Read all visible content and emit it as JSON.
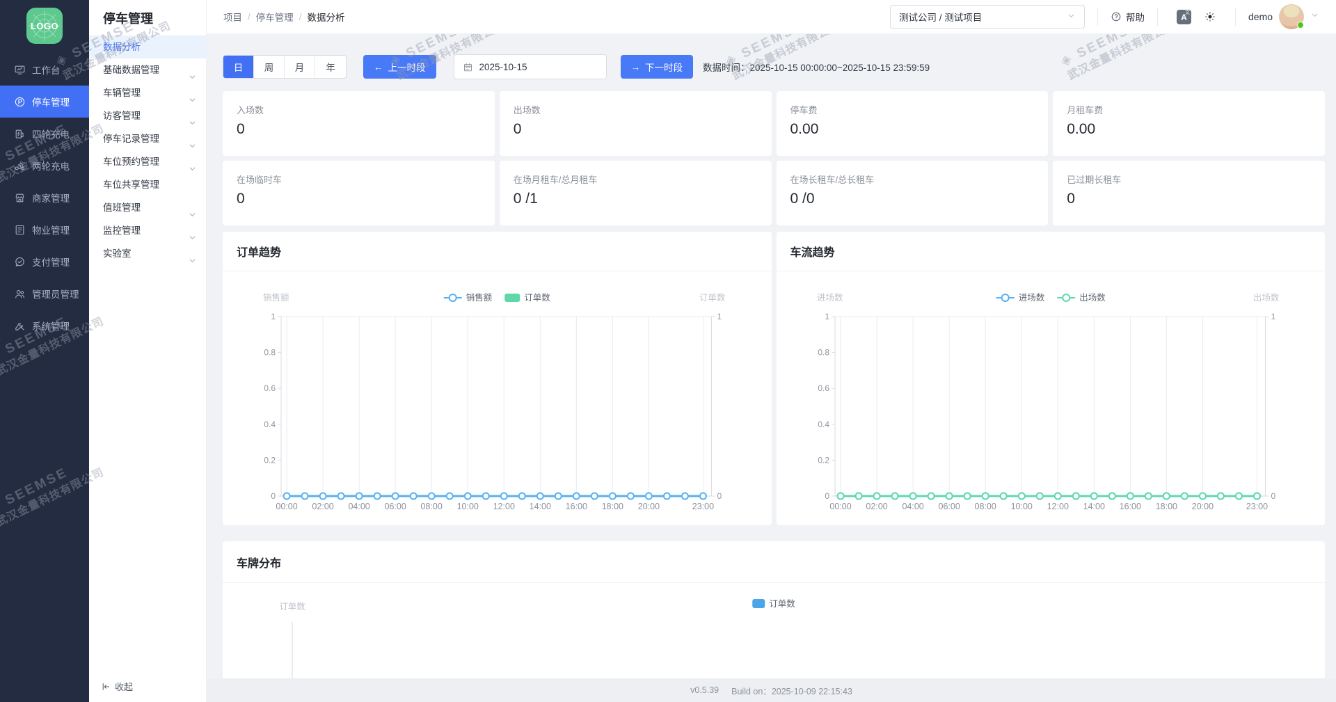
{
  "rail": {
    "logo": "LOGO",
    "items": [
      {
        "label": "工作台",
        "icon": "dashboard",
        "active": false
      },
      {
        "label": "停车管理",
        "icon": "parking",
        "active": true
      },
      {
        "label": "四轮充电",
        "icon": "car-charge",
        "active": false
      },
      {
        "label": "两轮充电",
        "icon": "bike-charge",
        "active": false
      },
      {
        "label": "商家管理",
        "icon": "merchant",
        "active": false
      },
      {
        "label": "物业管理",
        "icon": "property",
        "active": false
      },
      {
        "label": "支付管理",
        "icon": "payment",
        "active": false
      },
      {
        "label": "管理员管理",
        "icon": "admin",
        "active": false
      },
      {
        "label": "系统管理",
        "icon": "system",
        "active": false
      }
    ]
  },
  "submenu": {
    "title": "停车管理",
    "items": [
      {
        "label": "数据分析",
        "active": true,
        "has_children": false
      },
      {
        "label": "基础数据管理",
        "active": false,
        "has_children": true
      },
      {
        "label": "车辆管理",
        "active": false,
        "has_children": true
      },
      {
        "label": "访客管理",
        "active": false,
        "has_children": true
      },
      {
        "label": "停车记录管理",
        "active": false,
        "has_children": true
      },
      {
        "label": "车位预约管理",
        "active": false,
        "has_children": true
      },
      {
        "label": "车位共享管理",
        "active": false,
        "has_children": false
      },
      {
        "label": "值班管理",
        "active": false,
        "has_children": true
      },
      {
        "label": "监控管理",
        "active": false,
        "has_children": true
      },
      {
        "label": "实验室",
        "active": false,
        "has_children": true
      }
    ],
    "collapse_label": "收起"
  },
  "topbar": {
    "breadcrumb": [
      "项目",
      "停车管理",
      "数据分析"
    ],
    "project_select": "测试公司 / 测试项目",
    "help_label": "帮助",
    "username": "demo"
  },
  "toolbar": {
    "period_tabs": [
      "日",
      "周",
      "月",
      "年"
    ],
    "active_tab": "日",
    "prev_label": "上一时段",
    "next_label": "下一时段",
    "prev_arrow": "←",
    "next_arrow": "→",
    "date_value": "2025-10-15",
    "data_time_label": "数据时间：",
    "data_time_value": "2025-10-15 00:00:00~2025-10-15 23:59:59"
  },
  "stat_cards": [
    {
      "label": "入场数",
      "value": "0"
    },
    {
      "label": "出场数",
      "value": "0"
    },
    {
      "label": "停车费",
      "value": "0.00"
    },
    {
      "label": "月租车费",
      "value": "0.00"
    },
    {
      "label": "在场临时车",
      "value": "0"
    },
    {
      "label": "在场月租车/总月租车",
      "value": "0 /1"
    },
    {
      "label": "在场长租车/总长租车",
      "value": "0 /0"
    },
    {
      "label": "已过期长租车",
      "value": "0"
    }
  ],
  "chart_data": [
    {
      "type": "line",
      "title": "订单趋势",
      "ylabel_left": "销售额",
      "ylabel_right": "订单数",
      "ylim": [
        0,
        1
      ],
      "yticks": [
        0,
        0.2,
        0.4,
        0.6,
        0.8,
        1
      ],
      "yticks_right": [
        0,
        1
      ],
      "grid": true,
      "legend_position": "top-center",
      "x": [
        "00:00",
        "01:00",
        "02:00",
        "03:00",
        "04:00",
        "05:00",
        "06:00",
        "07:00",
        "08:00",
        "09:00",
        "10:00",
        "11:00",
        "12:00",
        "13:00",
        "14:00",
        "15:00",
        "16:00",
        "17:00",
        "18:00",
        "19:00",
        "20:00",
        "21:00",
        "22:00",
        "23:00"
      ],
      "x_shown_ticks": [
        "00:00",
        "02:00",
        "04:00",
        "06:00",
        "08:00",
        "10:00",
        "12:00",
        "14:00",
        "16:00",
        "18:00",
        "20:00",
        "23:00"
      ],
      "legend": [
        {
          "name": "销售额",
          "marker": "line",
          "color": "#56b1f2"
        },
        {
          "name": "订单数",
          "marker": "bar",
          "color": "#5fd8a8"
        }
      ],
      "series": [
        {
          "name": "销售额",
          "type": "line",
          "color": "#56b1f2",
          "values": [
            0,
            0,
            0,
            0,
            0,
            0,
            0,
            0,
            0,
            0,
            0,
            0,
            0,
            0,
            0,
            0,
            0,
            0,
            0,
            0,
            0,
            0,
            0,
            0
          ]
        },
        {
          "name": "订单数",
          "type": "bar",
          "color": "#5fd8a8",
          "values": [
            0,
            0,
            0,
            0,
            0,
            0,
            0,
            0,
            0,
            0,
            0,
            0,
            0,
            0,
            0,
            0,
            0,
            0,
            0,
            0,
            0,
            0,
            0,
            0
          ]
        }
      ]
    },
    {
      "type": "line",
      "title": "车流趋势",
      "ylabel_left": "进场数",
      "ylabel_right": "出场数",
      "ylim": [
        0,
        1
      ],
      "yticks": [
        0,
        0.2,
        0.4,
        0.6,
        0.8,
        1
      ],
      "yticks_right": [
        0,
        1
      ],
      "grid": true,
      "legend_position": "top-center",
      "x": [
        "00:00",
        "01:00",
        "02:00",
        "03:00",
        "04:00",
        "05:00",
        "06:00",
        "07:00",
        "08:00",
        "09:00",
        "10:00",
        "11:00",
        "12:00",
        "13:00",
        "14:00",
        "15:00",
        "16:00",
        "17:00",
        "18:00",
        "19:00",
        "20:00",
        "21:00",
        "22:00",
        "23:00"
      ],
      "x_shown_ticks": [
        "00:00",
        "02:00",
        "04:00",
        "06:00",
        "08:00",
        "10:00",
        "12:00",
        "14:00",
        "16:00",
        "18:00",
        "20:00",
        "23:00"
      ],
      "legend": [
        {
          "name": "进场数",
          "marker": "line",
          "color": "#56b1f2"
        },
        {
          "name": "出场数",
          "marker": "line",
          "color": "#5ed9ad"
        }
      ],
      "series": [
        {
          "name": "进场数",
          "type": "line",
          "color": "#56b1f2",
          "values": [
            0,
            0,
            0,
            0,
            0,
            0,
            0,
            0,
            0,
            0,
            0,
            0,
            0,
            0,
            0,
            0,
            0,
            0,
            0,
            0,
            0,
            0,
            0,
            0
          ]
        },
        {
          "name": "出场数",
          "type": "line",
          "color": "#5ed9ad",
          "values": [
            0,
            0,
            0,
            0,
            0,
            0,
            0,
            0,
            0,
            0,
            0,
            0,
            0,
            0,
            0,
            0,
            0,
            0,
            0,
            0,
            0,
            0,
            0,
            0
          ]
        }
      ]
    },
    {
      "type": "bar",
      "title": "车牌分布",
      "ylabel": "订单数",
      "legend": [
        {
          "name": "订单数",
          "marker": "bar",
          "color": "#49a6e8"
        }
      ],
      "categories": [],
      "values": []
    }
  ],
  "footer": {
    "version": "v0.5.39",
    "build_label": "Build on：",
    "build_time": "2025-10-09 22:15:43"
  },
  "watermark": {
    "line1": "SEEMSE",
    "line2": "武汉金量科技有限公司"
  },
  "colors": {
    "accent_blue": "#4270f4",
    "button_blue": "#4879f7",
    "line_blue": "#56b1f2",
    "line_green": "#5ed9ad",
    "legend_teal": "#5fd8a8",
    "legend_blue": "#49a6e8",
    "rail_bg": "#242c42",
    "logo_green": "#5ec98f"
  }
}
